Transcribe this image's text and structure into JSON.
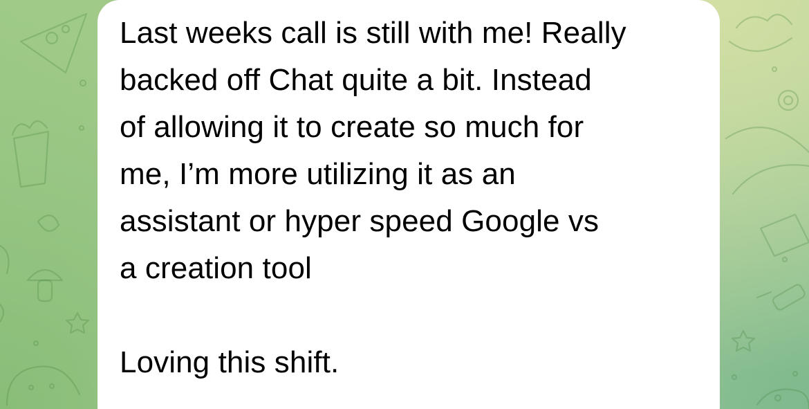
{
  "chat": {
    "wallpaper_colors": [
      "#9fca87",
      "#b3d39b",
      "#d2dfa4",
      "#7fb98d"
    ],
    "bubble_color": "#ffffff",
    "message": {
      "text": "Last weeks call is still with me! Really\nbacked off Chat quite a bit. Instead\nof allowing it to create so much for\nme, I’m more utilizing it as an\nassistant or hyper speed Google vs\na creation tool\n\nLoving this shift."
    }
  }
}
